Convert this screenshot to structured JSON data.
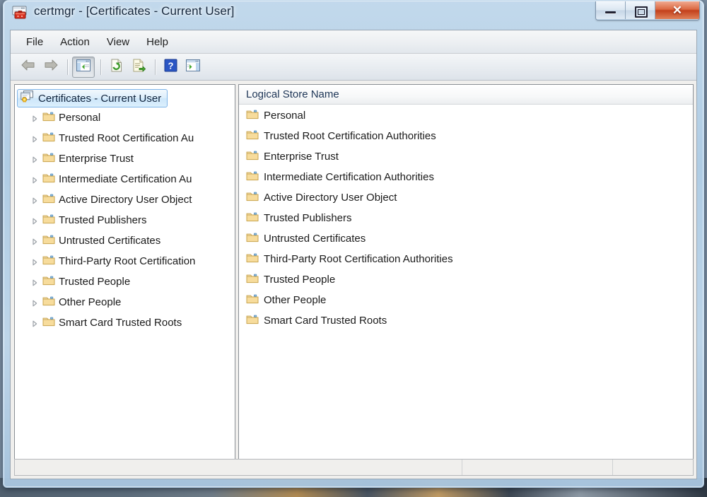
{
  "window": {
    "title": "certmgr - [Certificates - Current User]",
    "icon": "certmgr-icon",
    "controls": {
      "minimize": "─",
      "restore": "❐",
      "close": "✕"
    }
  },
  "menu": {
    "items": [
      {
        "label": "File"
      },
      {
        "label": "Action"
      },
      {
        "label": "View"
      },
      {
        "label": "Help"
      }
    ]
  },
  "toolbar": {
    "buttons": [
      {
        "name": "back-icon",
        "tooltip": "Back"
      },
      {
        "name": "forward-icon",
        "tooltip": "Forward"
      },
      {
        "name": "show-hide-tree-icon",
        "tooltip": "Show/Hide Console Tree",
        "pressed": true
      },
      {
        "name": "refresh-icon",
        "tooltip": "Refresh"
      },
      {
        "name": "export-list-icon",
        "tooltip": "Export List"
      },
      {
        "name": "help-icon",
        "tooltip": "Help"
      },
      {
        "name": "show-hide-action-pane-icon",
        "tooltip": "Show/Hide Action Pane"
      }
    ]
  },
  "tree": {
    "root": {
      "label": "Certificates - Current User",
      "icon": "certificate-console-icon",
      "selected": true
    },
    "nodes": [
      {
        "label": "Personal",
        "icon": "folder-icon",
        "expandable": true
      },
      {
        "label": "Trusted Root Certification Au",
        "icon": "folder-icon",
        "expandable": true
      },
      {
        "label": "Enterprise Trust",
        "icon": "folder-icon",
        "expandable": true
      },
      {
        "label": "Intermediate Certification Au",
        "icon": "folder-icon",
        "expandable": true
      },
      {
        "label": "Active Directory User Object",
        "icon": "folder-icon",
        "expandable": true
      },
      {
        "label": "Trusted Publishers",
        "icon": "folder-icon",
        "expandable": true
      },
      {
        "label": "Untrusted Certificates",
        "icon": "folder-icon",
        "expandable": true
      },
      {
        "label": "Third-Party Root Certification",
        "icon": "folder-icon",
        "expandable": true
      },
      {
        "label": "Trusted People",
        "icon": "folder-icon",
        "expandable": true
      },
      {
        "label": "Other People",
        "icon": "folder-icon",
        "expandable": true
      },
      {
        "label": "Smart Card Trusted Roots",
        "icon": "folder-icon",
        "expandable": true
      }
    ]
  },
  "list": {
    "column_header": "Logical Store Name",
    "rows": [
      {
        "label": "Personal",
        "icon": "folder-icon"
      },
      {
        "label": "Trusted Root Certification Authorities",
        "icon": "folder-icon"
      },
      {
        "label": "Enterprise Trust",
        "icon": "folder-icon"
      },
      {
        "label": "Intermediate Certification Authorities",
        "icon": "folder-icon"
      },
      {
        "label": "Active Directory User Object",
        "icon": "folder-icon"
      },
      {
        "label": "Trusted Publishers",
        "icon": "folder-icon"
      },
      {
        "label": "Untrusted Certificates",
        "icon": "folder-icon"
      },
      {
        "label": "Third-Party Root Certification Authorities",
        "icon": "folder-icon"
      },
      {
        "label": "Trusted People",
        "icon": "folder-icon"
      },
      {
        "label": "Other People",
        "icon": "folder-icon"
      },
      {
        "label": "Smart Card Trusted Roots",
        "icon": "folder-icon"
      }
    ]
  },
  "scrollbars": {
    "tree": {
      "left_arrow": "◀",
      "right_arrow": "▶",
      "grip": "⫴"
    },
    "list": {
      "left_arrow": "◀",
      "right_arrow": "▶",
      "grip": "⫴"
    }
  },
  "status_bar": {
    "segments": [
      "",
      "",
      ""
    ]
  },
  "colors": {
    "accent": "#7eb4e8",
    "close_button": "#c3401b",
    "folder": "#f2d491",
    "title_text": "#16273c"
  }
}
